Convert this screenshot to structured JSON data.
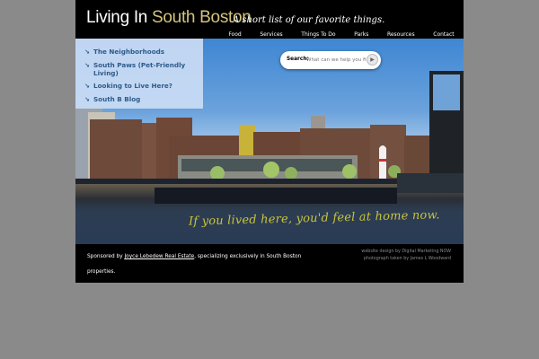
{
  "header": {
    "logo_main": "Living In ",
    "logo_accent": "South Boston",
    "tagline": "A short list of our favorite things."
  },
  "nav": [
    "Food",
    "Services",
    "Things To Do",
    "Parks",
    "Resources",
    "Contact"
  ],
  "sidebar": {
    "items": [
      {
        "label": "The Neighborhoods"
      },
      {
        "label": "South Paws (Pet-Friendly Living)"
      },
      {
        "label": "Looking to Live Here?"
      },
      {
        "label": "South B Blog"
      }
    ],
    "arrow_glyph": "↘"
  },
  "search": {
    "label": "Search:",
    "placeholder": "What can we help you find?",
    "button_glyph": "▶"
  },
  "hero": {
    "overlay_text": "If you lived here, you'd feel at home now."
  },
  "footer": {
    "sponsor_prefix": "Sponsored by ",
    "sponsor_link": "Joyce Lebedew Real Estate",
    "sponsor_suffix": ", specializing exclusively in South Boston properties.",
    "credit_design": "website design by Digital Marketing NOW",
    "credit_photo": "photograph taken by James L Woodward"
  },
  "colors": {
    "logo_accent": "#d4c47a",
    "sidebar_text": "#2d5b8a",
    "overlay_text": "#c9c43a",
    "page_background": "#8a8a8a"
  }
}
